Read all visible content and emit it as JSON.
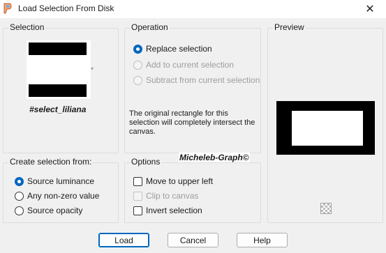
{
  "window": {
    "title": "Load Selection From Disk",
    "close_glyph": "✕",
    "app_icon": "psp-icon"
  },
  "selection_group": {
    "label": "Selection",
    "selection_name": "#select_liliana"
  },
  "operation_group": {
    "label": "Operation",
    "options": [
      {
        "label": "Replace selection",
        "selected": true,
        "enabled": true
      },
      {
        "label": "Add to current selection",
        "selected": false,
        "enabled": false
      },
      {
        "label": "Subtract from current selection",
        "selected": false,
        "enabled": false
      }
    ],
    "info": "The original rectangle for this selection will completely intersect the canvas."
  },
  "preview_group": {
    "label": "Preview"
  },
  "create_group": {
    "label": "Create selection from:",
    "options": [
      {
        "label": "Source luminance",
        "selected": true
      },
      {
        "label": "Any non-zero value",
        "selected": false
      },
      {
        "label": "Source opacity",
        "selected": false
      }
    ]
  },
  "options_group": {
    "label": "Options",
    "items": [
      {
        "label": "Move to upper left",
        "checked": false,
        "enabled": true
      },
      {
        "label": "Clip to canvas",
        "checked": false,
        "enabled": false
      },
      {
        "label": "Invert selection",
        "checked": false,
        "enabled": true
      }
    ]
  },
  "watermark": "Micheleb-Graph©",
  "buttons": {
    "load": "Load",
    "cancel": "Cancel",
    "help": "Help"
  }
}
